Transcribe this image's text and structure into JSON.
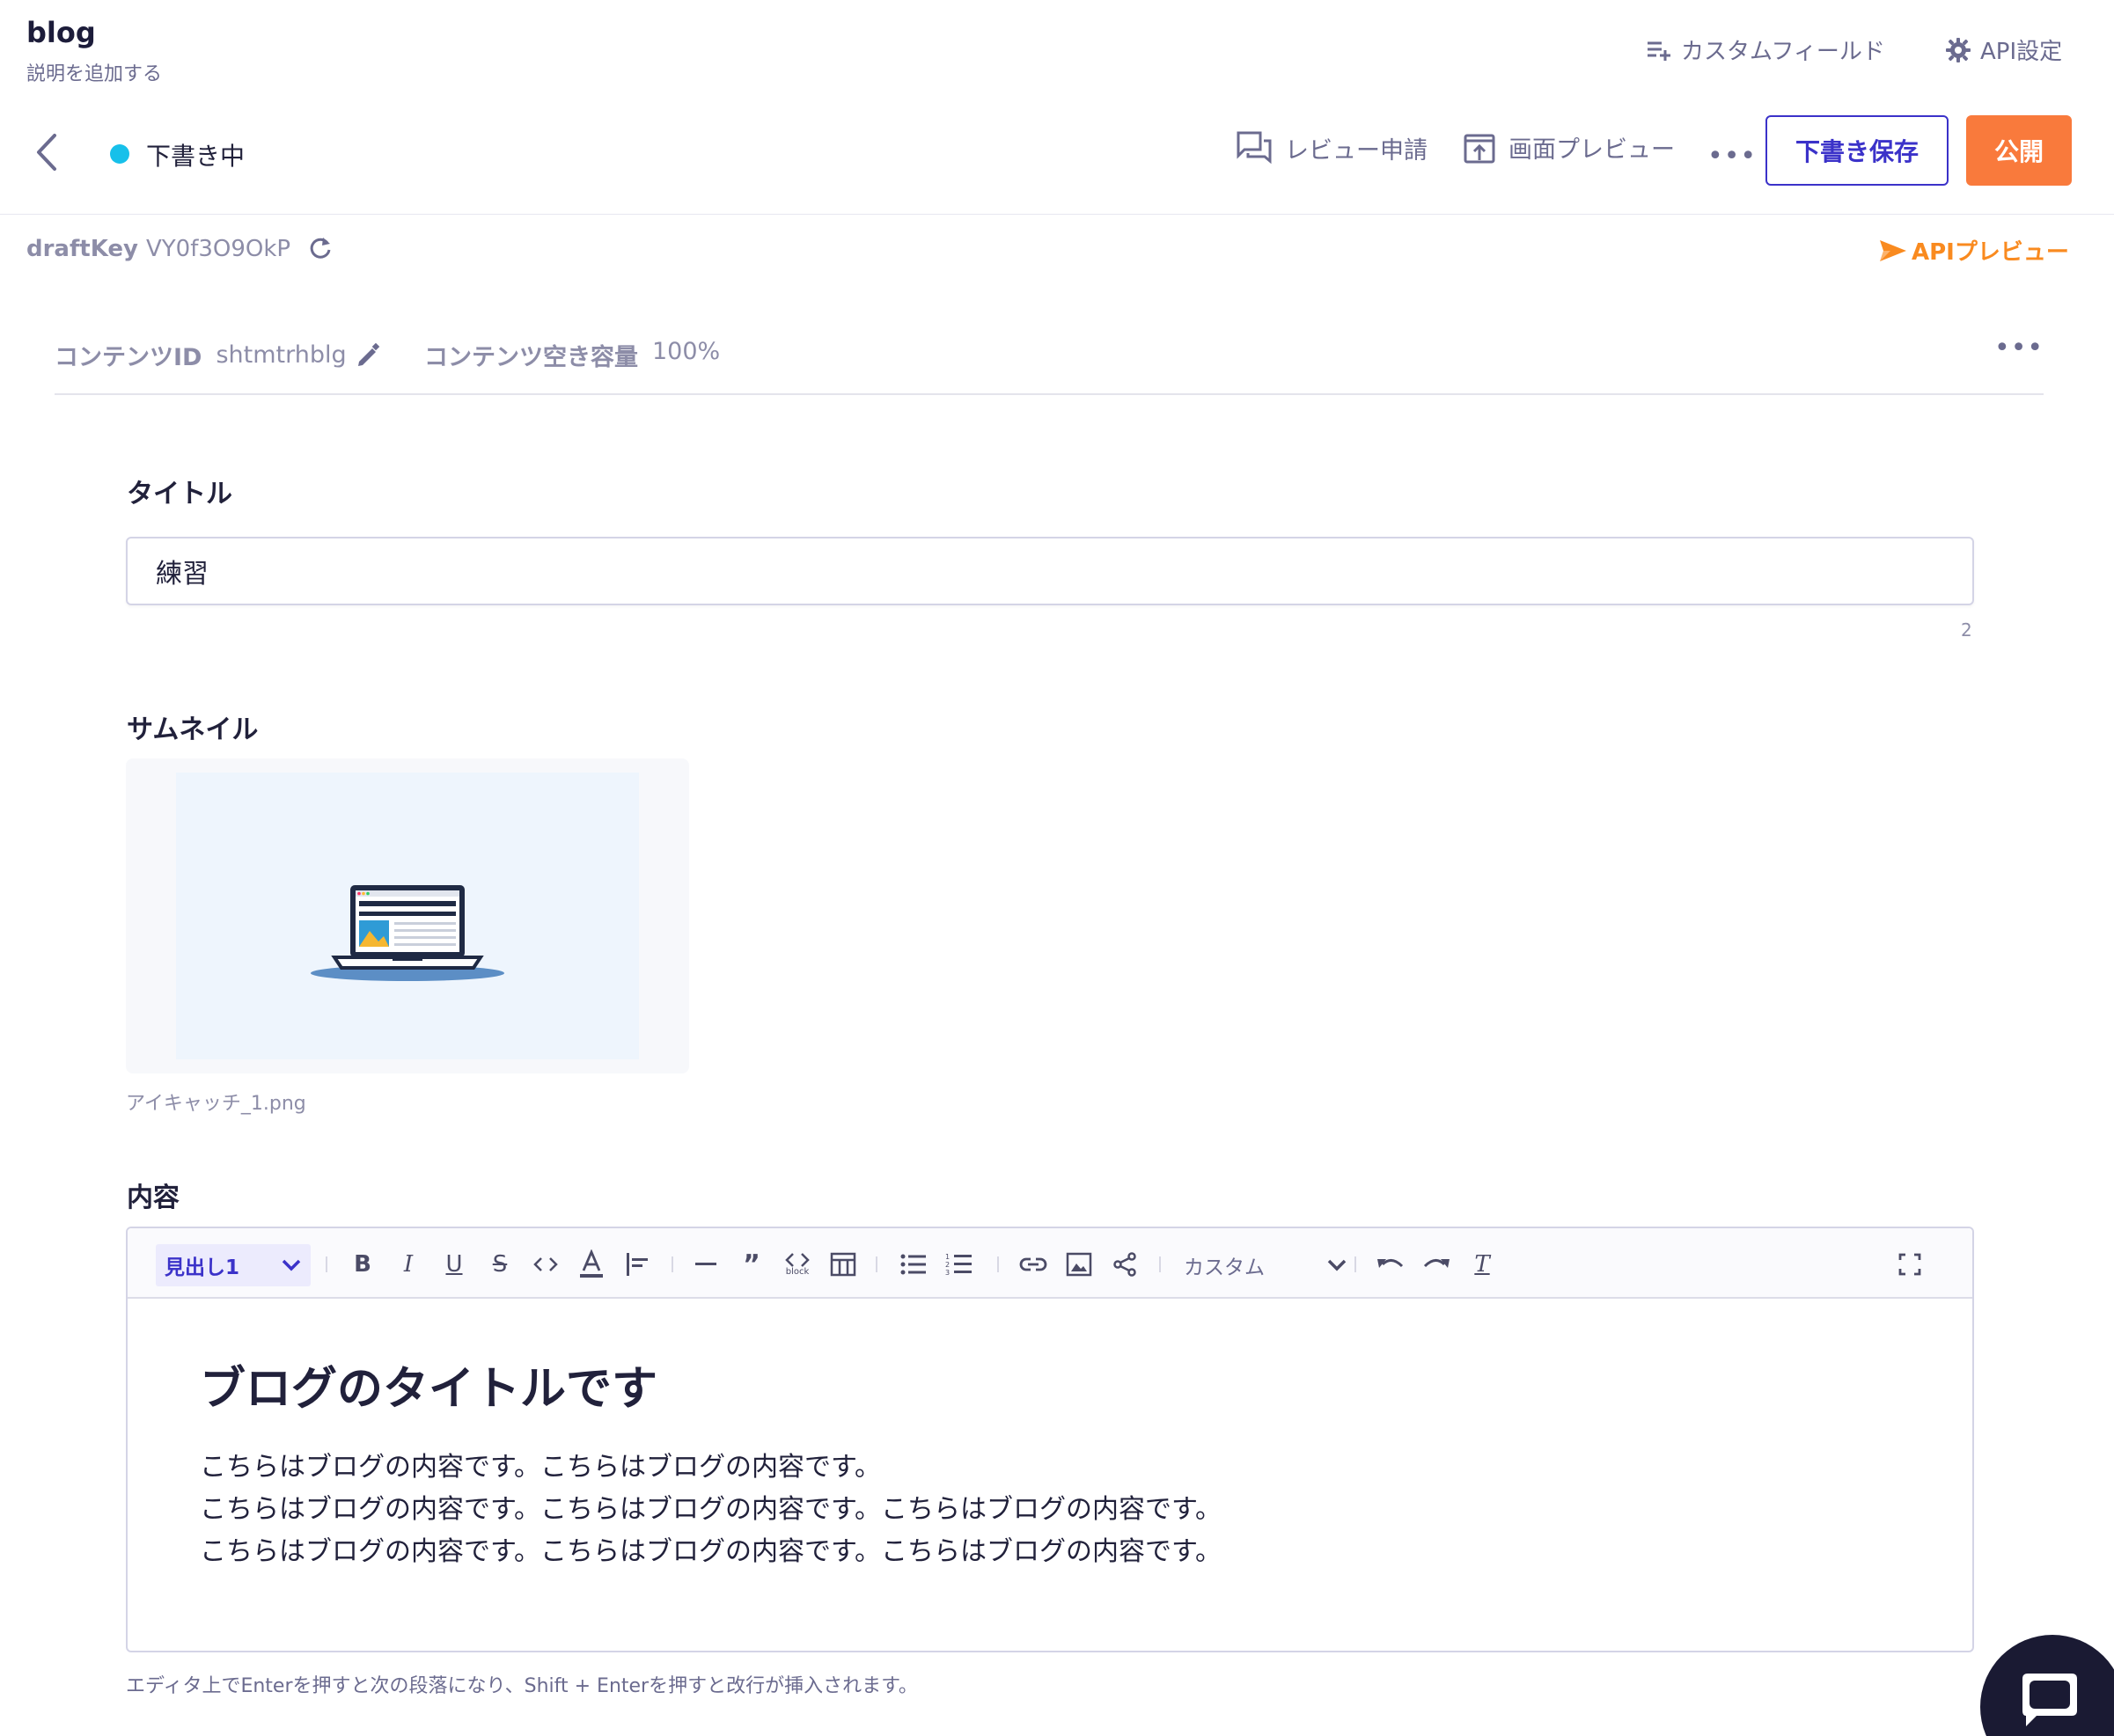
{
  "header": {
    "app_title": "blog",
    "app_description": "説明を追加する",
    "custom_field_label": "カスタムフィールド",
    "api_settings_label": "API設定"
  },
  "actions": {
    "status_text": "下書き中",
    "status_color": "#17c0ea",
    "review_label": "レビュー申請",
    "preview_label": "画面プレビュー",
    "more_label": "•••",
    "save_draft_label": "下書き保存",
    "publish_label": "公開",
    "accent_color": "#3b32c9",
    "publish_color": "#f97a3c"
  },
  "draft": {
    "key_label": "draftKey",
    "key_value": "VY0f3O9OkP",
    "api_preview_label": "APIプレビュー"
  },
  "meta": {
    "content_id_label": "コンテンツID",
    "content_id_value": "shtmtrhblg",
    "capacity_label": "コンテンツ空き容量",
    "capacity_value": "100%",
    "more_label": "•••"
  },
  "fields": {
    "title_label": "タイトル",
    "title_value": "練習",
    "title_count": "2",
    "thumbnail_label": "サムネイル",
    "thumbnail_filename": "アイキャッチ_1.png",
    "content_label": "内容"
  },
  "editor": {
    "heading_select": "見出し1",
    "custom_select": "カスタム",
    "block_label": "block",
    "heading": "ブログのタイトルです",
    "paragraphs": [
      "こちらはブログの内容です。こちらはブログの内容です。",
      "こちらはブログの内容です。こちらはブログの内容です。こちらはブログの内容です。",
      "こちらはブログの内容です。こちらはブログの内容です。こちらはブログの内容です。"
    ],
    "hint": "エディタ上でEnterを押すと次の段落になり、Shift + Enterを押すと改行が挿入されます。",
    "toolbar_icons": [
      "bold-icon",
      "italic-icon",
      "underline-icon",
      "strikethrough-icon",
      "code-icon",
      "text-color-icon",
      "align-icon",
      "horizontal-rule-icon",
      "quote-icon",
      "code-block-icon",
      "table-icon",
      "bullet-list-icon",
      "ordered-list-icon",
      "link-icon",
      "image-icon",
      "embed-icon",
      "undo-icon",
      "redo-icon",
      "clear-format-icon",
      "fullscreen-icon"
    ]
  }
}
